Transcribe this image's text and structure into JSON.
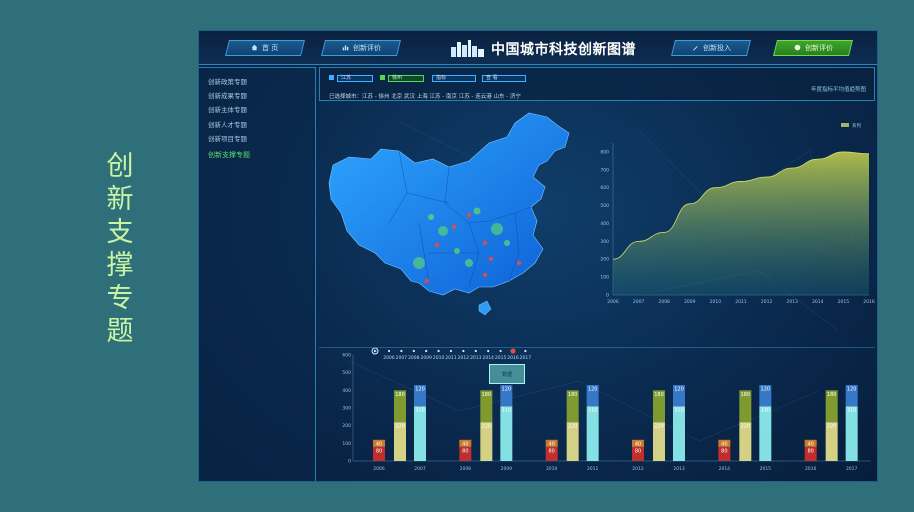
{
  "slide": {
    "title_chars": [
      "创",
      "新",
      "支",
      "撑",
      "专",
      "题"
    ]
  },
  "topbar": {
    "brand": "中国城市科技创新图谱",
    "nav": [
      {
        "label": "首 页",
        "icon": "home-icon"
      },
      {
        "label": "创新评价",
        "icon": "bar-chart-icon"
      },
      {
        "label": "创新投入",
        "icon": "pen-icon"
      },
      {
        "label": "创新评价",
        "icon": "circle-icon",
        "active": true
      }
    ]
  },
  "sidebar": {
    "items": [
      "创新政策专题",
      "创新成果专题",
      "创新主体专题",
      "创新人才专题",
      "创新项目专题",
      "创新支撑专题"
    ],
    "active_index": 5
  },
  "filters": {
    "select1": "江苏",
    "select2": "徐州",
    "select3": "指标",
    "select4": "查 看",
    "selected_cities_label": "已选择城市：",
    "selected_cities": "江苏 - 徐州    北京    武汉    上海    江苏 - 南京    江苏 - 连云港    山东 - 济宁",
    "chart_caption": "年度指标平均值趋势图"
  },
  "timeline": {
    "years": [
      "2006",
      "2007",
      "2008",
      "2009",
      "2010",
      "2011",
      "2012",
      "2013",
      "2014",
      "2015",
      "2016",
      "2017"
    ],
    "current": "2016"
  },
  "chart_data": [
    {
      "type": "area",
      "legend": "系列",
      "x": [
        "2006",
        "2007",
        "2008",
        "2009",
        "2010",
        "2011",
        "2012",
        "2013",
        "2014",
        "2015",
        "2016"
      ],
      "y": [
        200,
        300,
        350,
        510,
        600,
        635,
        660,
        710,
        760,
        800,
        790
      ],
      "yticks": [
        0,
        100,
        200,
        300,
        400,
        500,
        600,
        700,
        800
      ],
      "ylim": [
        0,
        850
      ]
    },
    {
      "type": "bar",
      "groups": [
        {
          "years": [
            "2006",
            "2007"
          ],
          "values": [
            80,
            40,
            220,
            180,
            310,
            120
          ]
        },
        {
          "years": [
            "2008",
            "2009"
          ],
          "values": [
            80,
            40,
            220,
            180,
            310,
            120
          ]
        },
        {
          "years": [
            "2010",
            "2011"
          ],
          "values": [
            80,
            40,
            220,
            180,
            310,
            120
          ]
        },
        {
          "years": [
            "2012",
            "2013"
          ],
          "values": [
            80,
            40,
            220,
            180,
            310,
            120
          ]
        },
        {
          "years": [
            "2014",
            "2015"
          ],
          "values": [
            80,
            40,
            220,
            180,
            310,
            120
          ]
        },
        {
          "years": [
            "2016",
            "2017"
          ],
          "values": [
            80,
            40,
            220,
            180,
            310,
            120
          ]
        }
      ],
      "yticks": [
        0,
        100,
        200,
        300,
        400,
        500,
        600
      ],
      "ylim": [
        0,
        600
      ],
      "colors": {
        "red": "#d0302a",
        "orange": "#d9822b",
        "yellow": "#e6e08a",
        "olive": "#8aa52c",
        "cyan": "#8ff0f0",
        "blue": "#3b7fd1"
      }
    }
  ],
  "tooltip": {
    "text": "数据"
  }
}
